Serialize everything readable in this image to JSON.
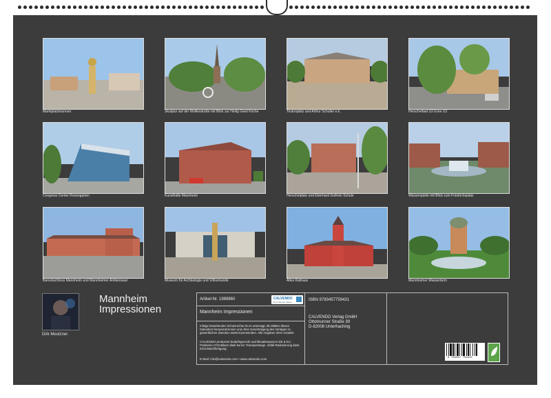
{
  "photos": [
    {
      "caption": "Marktplatzbrunnen"
    },
    {
      "caption": "Skulptur auf der Moltkestraße mit Blick zur Heilig Geist Kirche"
    },
    {
      "caption": "Toulonplatz und Arthur Schuller e.k."
    },
    {
      "caption": "Herschelbad U2 Ecke U3"
    },
    {
      "caption": "Congress Center Rosengarten"
    },
    {
      "caption": "Kunsthalle Mannheim"
    },
    {
      "caption": "Herschelplatz und Eberhard Gothein Schule"
    },
    {
      "caption": "Wasserspiele mit Blick zum Friedrichsplatz"
    },
    {
      "caption": "Barockschloss Mannheim und Mannheimer Antikensaal"
    },
    {
      "caption": "Museum für Archäologie und Völkerkunde"
    },
    {
      "caption": "Altes Rathaus"
    },
    {
      "caption": "Mannheimer Wasserturm"
    }
  ],
  "title_line1": "Mannheim",
  "title_line2": "Impressionen",
  "author": "Dirk Meutzner",
  "info": {
    "article": "Artikel-Nr. 1989860",
    "logo_text": "CALVENDO",
    "logo_sub": "Die Kalender-Marke",
    "isbn": "ISBN 9783457759431",
    "calendar_title": "Mannheim Impressionen",
    "publisher_1": "CALVENDO Verlag GmbH",
    "publisher_2": "Ottobrunner Straße 39",
    "publisher_3": "D-82008 Unterhaching",
    "legal_1": "Infolge bestehender Schutzrechte ist es untersagt, die Blätter dieses Kalenders herauszutrennen und ohne Genehmigung des Verlages zu gewerblichen Zwecken weiterzuverwenden. Alle Angaben ohne Gewähr.",
    "legal_2": "CALVENDO produziert bedarfsgerecht und klimabewusst in DE & EU. Positivere CO2-Bilanz dank kurzer Transportwege. Abfall-Reduzierung dank Einzelstückfertigung.",
    "email": "E-Mail: info@calvendo.com • www.calvendo.com",
    "barcode_number": "9 783457 759431"
  }
}
